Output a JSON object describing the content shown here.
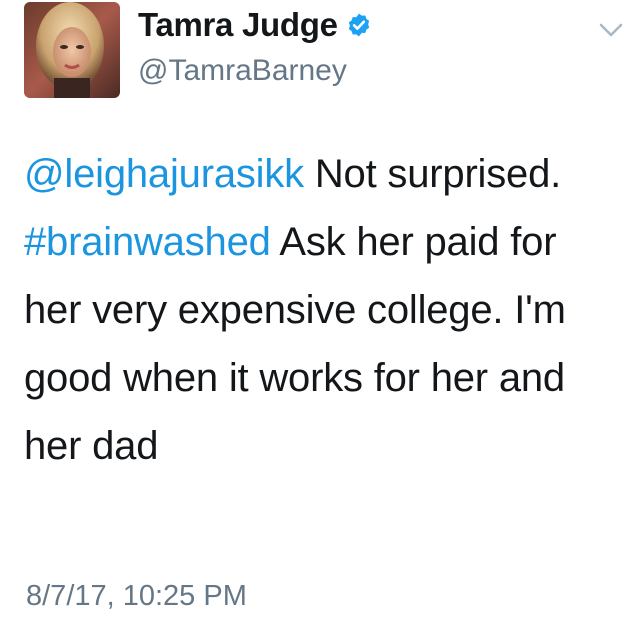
{
  "author": {
    "display_name": "Tamra Judge",
    "handle": "@TamraBarney",
    "verified": true,
    "avatar_icon": "profile-photo"
  },
  "tweet": {
    "mention": "@leighajurasikk",
    "text_part1": " Not surprised.  ",
    "hashtag": "#brainwashed",
    "text_part2": " Ask her paid for her very expensive college. I'm good when it works for her and her dad"
  },
  "timestamp": "8/7/17, 10:25 PM",
  "colors": {
    "link": "#1b95e0",
    "verified": "#1da1f2",
    "secondary_text": "#657786",
    "primary_text": "#14171a"
  }
}
